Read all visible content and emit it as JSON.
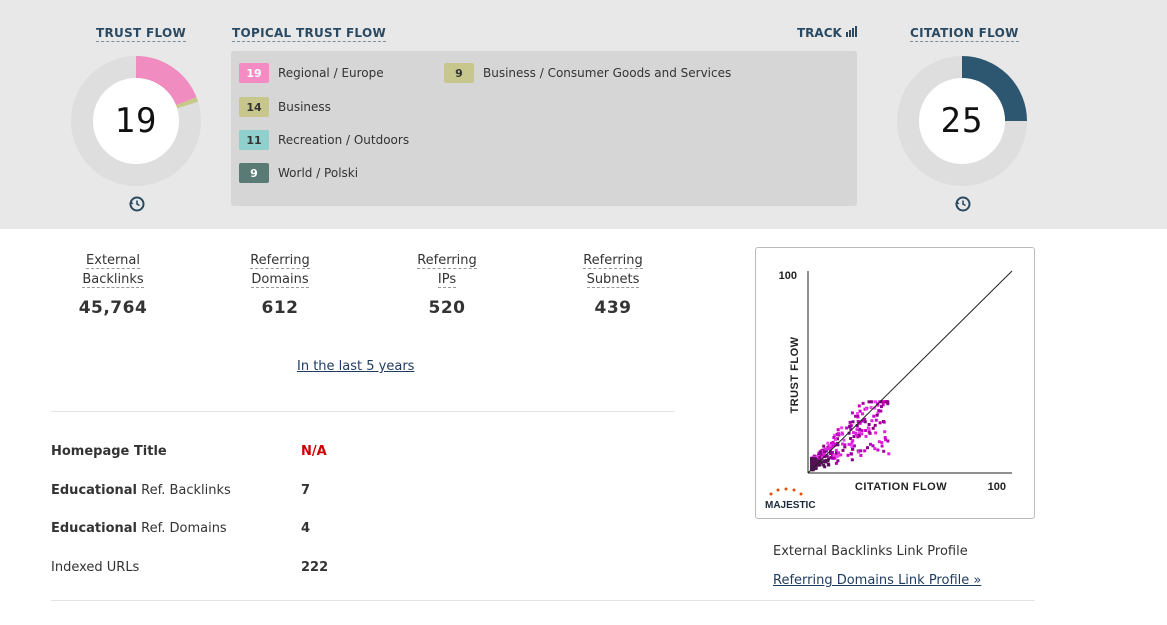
{
  "trust_flow": {
    "title": "TRUST FLOW",
    "value": "19",
    "color": "#f08cc0",
    "secondary_color": "#c8c888",
    "history_icon": "history-icon"
  },
  "topical_trust_flow": {
    "title": "TOPICAL TRUST FLOW",
    "items": [
      {
        "score": "19",
        "label": "Regional / Europe",
        "color": "#f58bc3"
      },
      {
        "score": "14",
        "label": "Business",
        "color": "#c7c78d"
      },
      {
        "score": "11",
        "label": "Recreation / Outdoors",
        "color": "#8fcfcc"
      },
      {
        "score": "9",
        "label": "World / Polski",
        "color": "#5a7a76"
      },
      {
        "score": "9",
        "label": "Business / Consumer Goods and Services",
        "color": "#c7c78d"
      }
    ]
  },
  "track": {
    "label": "TRACK",
    "icon": "bar-chart-icon"
  },
  "citation_flow": {
    "title": "CITATION FLOW",
    "value": "25",
    "color": "#2d5670",
    "history_icon": "history-icon"
  },
  "stats": [
    {
      "label_line1": "External",
      "label_line2": "Backlinks",
      "value": "45,764"
    },
    {
      "label_line1": "Referring",
      "label_line2": "Domains",
      "value": "612"
    },
    {
      "label_line1": "Referring",
      "label_line2": "IPs",
      "value": "520"
    },
    {
      "label_line1": "Referring",
      "label_line2": "Subnets",
      "value": "439"
    }
  ],
  "period_link": "In the last 5 years",
  "info": [
    {
      "label_bold": "Homepage Title",
      "label_rest": "",
      "value": "N/A",
      "value_color": "#cc0000"
    },
    {
      "label_bold": "Educational",
      "label_rest": " Ref. Backlinks",
      "value": "7"
    },
    {
      "label_bold": "Educational",
      "label_rest": " Ref. Domains",
      "value": "4"
    },
    {
      "label_bold": "",
      "label_rest": "Indexed URLs",
      "value": "222"
    }
  ],
  "chart_data": {
    "type": "scatter",
    "xlabel": "CITATION FLOW",
    "ylabel": "TRUST FLOW",
    "xlim": [
      0,
      100
    ],
    "ylim": [
      0,
      100
    ],
    "x_max_label": "100",
    "y_max_label": "100",
    "diagonal": true,
    "logo": "MAJESTIC",
    "point_color": "#cc00cc"
  },
  "profile": {
    "text": "External Backlinks Link Profile",
    "link": "Referring Domains Link Profile »"
  }
}
